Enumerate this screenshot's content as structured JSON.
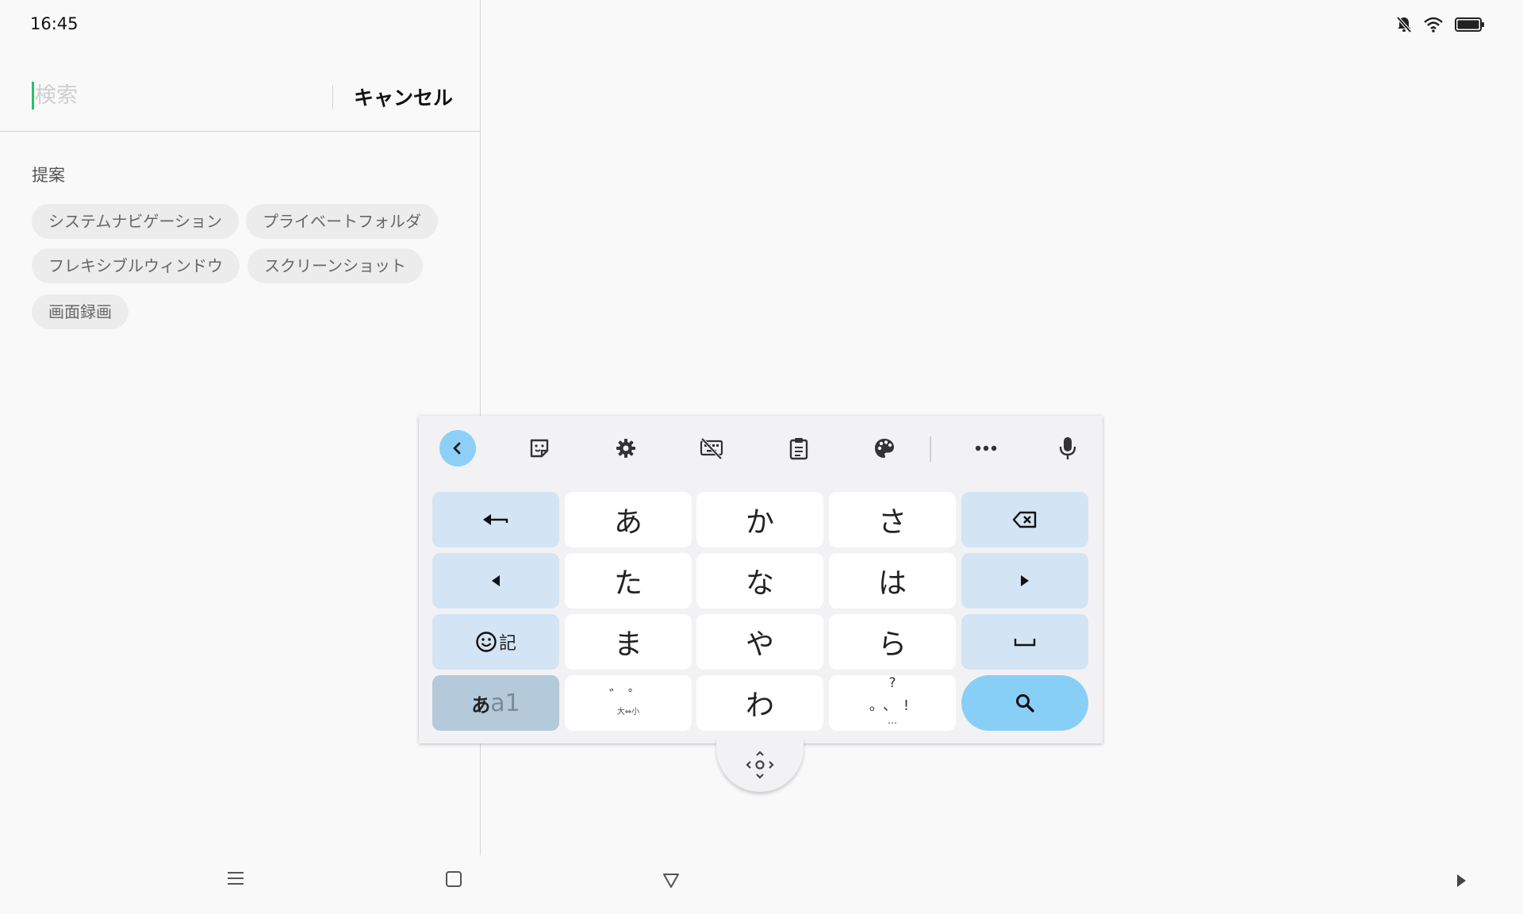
{
  "status_bar": {
    "time": "16:45",
    "icons": [
      "bell-off-icon",
      "wifi-icon",
      "battery-icon"
    ]
  },
  "search": {
    "placeholder": "検索",
    "value": "",
    "cancel_label": "キャンセル"
  },
  "suggestions": {
    "title": "提案",
    "chips": [
      "システムナビゲーション",
      "プライベートフォルダ",
      "フレキシブルウィンドウ",
      "スクリーンショット",
      "画面録画"
    ]
  },
  "keyboard": {
    "toolbar": [
      "back-icon",
      "sticker-icon",
      "gear-icon",
      "keyboard-off-icon",
      "clipboard-icon",
      "palette-icon",
      "more-icon",
      "microphone-icon"
    ],
    "keys": {
      "a": "あ",
      "ka": "か",
      "sa": "さ",
      "ta": "た",
      "na": "な",
      "ha": "は",
      "ma": "ま",
      "ya": "や",
      "ra": "ら",
      "wa": "わ",
      "emoji_kigo": "記",
      "mode_kana": "あ",
      "mode_alpha": "a1",
      "dakuten": "゛゜",
      "dakuten_sub": "大⇔小",
      "punct_top": "?",
      "punct_mid": "。、!",
      "punct_bottom": "…"
    },
    "colors": {
      "function_key": "#d3e4f4",
      "search_key": "#88cff8",
      "mode_key": "#b4c9da"
    }
  },
  "nav_bar": [
    "menu-icon",
    "home-square-icon",
    "back-triangle-icon",
    "play-icon"
  ],
  "accent_color": "#2cc06a"
}
